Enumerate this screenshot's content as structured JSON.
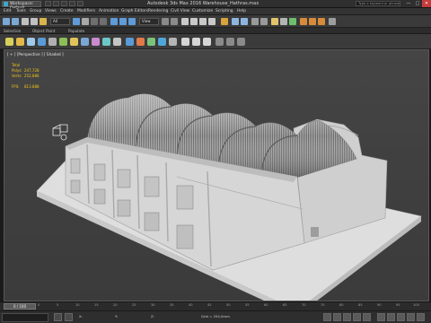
{
  "title_bar": {
    "workspace": "Workspace: Default",
    "window_title": "Autodesk 3ds Max 2016    Warehouse_Hathras.max",
    "search_placeholder": "Type a keyword or phrase",
    "minimize": "—",
    "maximize": "□",
    "close": "✕"
  },
  "menu_bar": {
    "items": [
      "Edit",
      "Tools",
      "Group",
      "Views",
      "Create",
      "Modifiers",
      "Animation",
      "Graph Editors",
      "Rendering",
      "Civil View",
      "Customize",
      "Scripting",
      "Help"
    ]
  },
  "toolbar": {
    "selection_filter": "All",
    "reference_coord": "View"
  },
  "ribbon_tabs": {
    "items": [
      "Selection",
      "Object Paint",
      "Populate"
    ]
  },
  "viewport": {
    "label": "[ + ] [Perspective ] [ Shaded ]",
    "stats": {
      "header": "Total",
      "polys_label": "Polys:",
      "polys_value": "247,728",
      "verts_label": "Verts:",
      "verts_value": "252,886",
      "fps_label": "FPS:",
      "fps_value": "813.888"
    }
  },
  "timeline": {
    "frame": "0 / 100",
    "tick_labels": [
      "0",
      "5",
      "10",
      "15",
      "20",
      "25",
      "30",
      "35",
      "40",
      "45",
      "50",
      "55",
      "60",
      "65",
      "70",
      "75",
      "80",
      "85",
      "90",
      "95",
      "100"
    ]
  },
  "status_bar": {
    "x_label": "X:",
    "y_label": "Y:",
    "z_label": "Z:",
    "grid": "Grid = 254,0mm"
  }
}
